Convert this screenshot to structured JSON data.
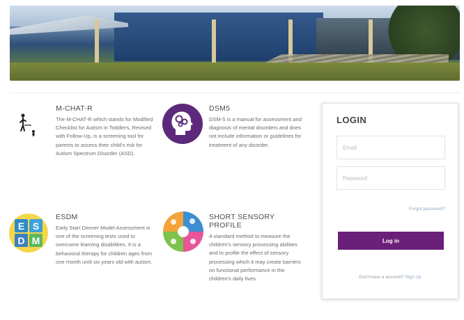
{
  "login": {
    "heading": "LOGIN",
    "email_placeholder": "Email",
    "password_placeholder": "Password",
    "forgot_label": "Forgot password?",
    "submit_label": "Log in",
    "signup_prompt": "Don't have a account?",
    "signup_link": "Sign Up",
    "accent_color": "#6a1f78"
  },
  "features": {
    "mchat": {
      "title": "M-CHAT-R",
      "description": "The M-CHAT-R which stands for Modified Checklist for Autism in Toddlers, Revised with Follow-Up, is a screening tool for parents to assess their child's risk for Autism Spectrum Disorder (ASD).",
      "icon": "child-figure-icon"
    },
    "dsm": {
      "title": "DSM5",
      "description": "DSM-5 is a manual for assessment and diagnosis of mental disorders and does not include information or guidelines for treatment of any disorder.",
      "icon": "head-gears-icon"
    },
    "esdm": {
      "title": "ESDM",
      "description": "Early Start Denver Model Assessment is one of the screening tests used to overcome learning disabilities. It is a behavioral therapy for children ages from one month until six years old with autism.",
      "icon": "esdm-logo-icon"
    },
    "ssp": {
      "title": "SHORT SENSORY PROFILE",
      "description": "A standard method to measure the children's sensory processing abilities and to profile the effect of sensory processing which it may create barriers on functional performance in the children's daily lives.",
      "icon": "sensory-profile-icon"
    }
  }
}
